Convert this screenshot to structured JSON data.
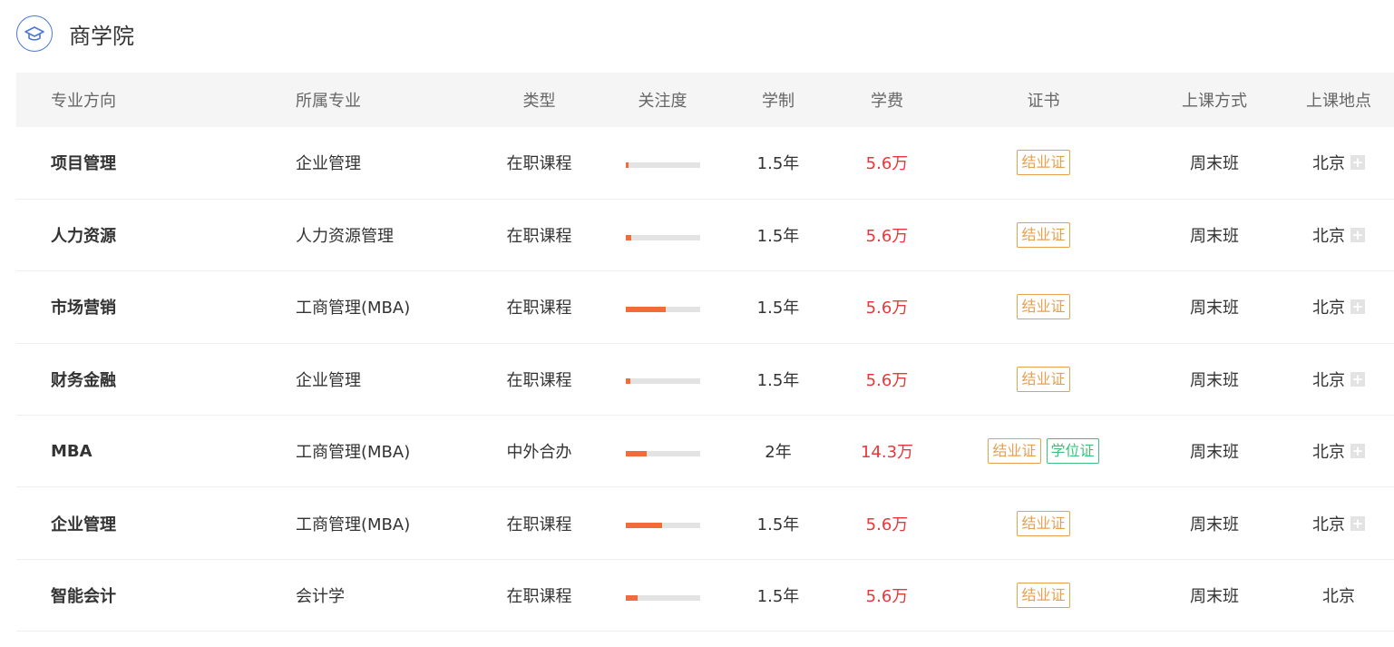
{
  "header": {
    "title": "商学院",
    "icon": "graduation-cap-icon"
  },
  "columns": [
    "专业方向",
    "所属专业",
    "类型",
    "关注度",
    "学制",
    "学费",
    "证书",
    "上课方式",
    "上课地点"
  ],
  "rows": [
    {
      "direction": "项目管理",
      "major": "企业管理",
      "type": "在职课程",
      "attention": 0.04,
      "duration": "1.5年",
      "fee": "5.6万",
      "certs": [
        "结业证"
      ],
      "mode": "周末班",
      "location": "北京",
      "has_plus": true
    },
    {
      "direction": "人力资源",
      "major": "人力资源管理",
      "type": "在职课程",
      "attention": 0.08,
      "duration": "1.5年",
      "fee": "5.6万",
      "certs": [
        "结业证"
      ],
      "mode": "周末班",
      "location": "北京",
      "has_plus": true
    },
    {
      "direction": "市场营销",
      "major": "工商管理(MBA)",
      "type": "在职课程",
      "attention": 0.54,
      "duration": "1.5年",
      "fee": "5.6万",
      "certs": [
        "结业证"
      ],
      "mode": "周末班",
      "location": "北京",
      "has_plus": true
    },
    {
      "direction": "财务金融",
      "major": "企业管理",
      "type": "在职课程",
      "attention": 0.07,
      "duration": "1.5年",
      "fee": "5.6万",
      "certs": [
        "结业证"
      ],
      "mode": "周末班",
      "location": "北京",
      "has_plus": true
    },
    {
      "direction": "MBA",
      "major": "工商管理(MBA)",
      "type": "中外合办",
      "attention": 0.29,
      "duration": "2年",
      "fee": "14.3万",
      "certs": [
        "结业证",
        "学位证"
      ],
      "mode": "周末班",
      "location": "北京",
      "has_plus": true
    },
    {
      "direction": "企业管理",
      "major": "工商管理(MBA)",
      "type": "在职课程",
      "attention": 0.49,
      "duration": "1.5年",
      "fee": "5.6万",
      "certs": [
        "结业证"
      ],
      "mode": "周末班",
      "location": "北京",
      "has_plus": true
    },
    {
      "direction": "智能会计",
      "major": "会计学",
      "type": "在职课程",
      "attention": 0.16,
      "duration": "1.5年",
      "fee": "5.6万",
      "certs": [
        "结业证"
      ],
      "mode": "周末班",
      "location": "北京",
      "has_plus": false
    }
  ],
  "colors": {
    "accent": "#4a78d6",
    "bar_fill": "#f26b3a",
    "fee": "#e5383b",
    "cert_orange": "#e8a04f",
    "cert_green": "#3fbf7a"
  }
}
